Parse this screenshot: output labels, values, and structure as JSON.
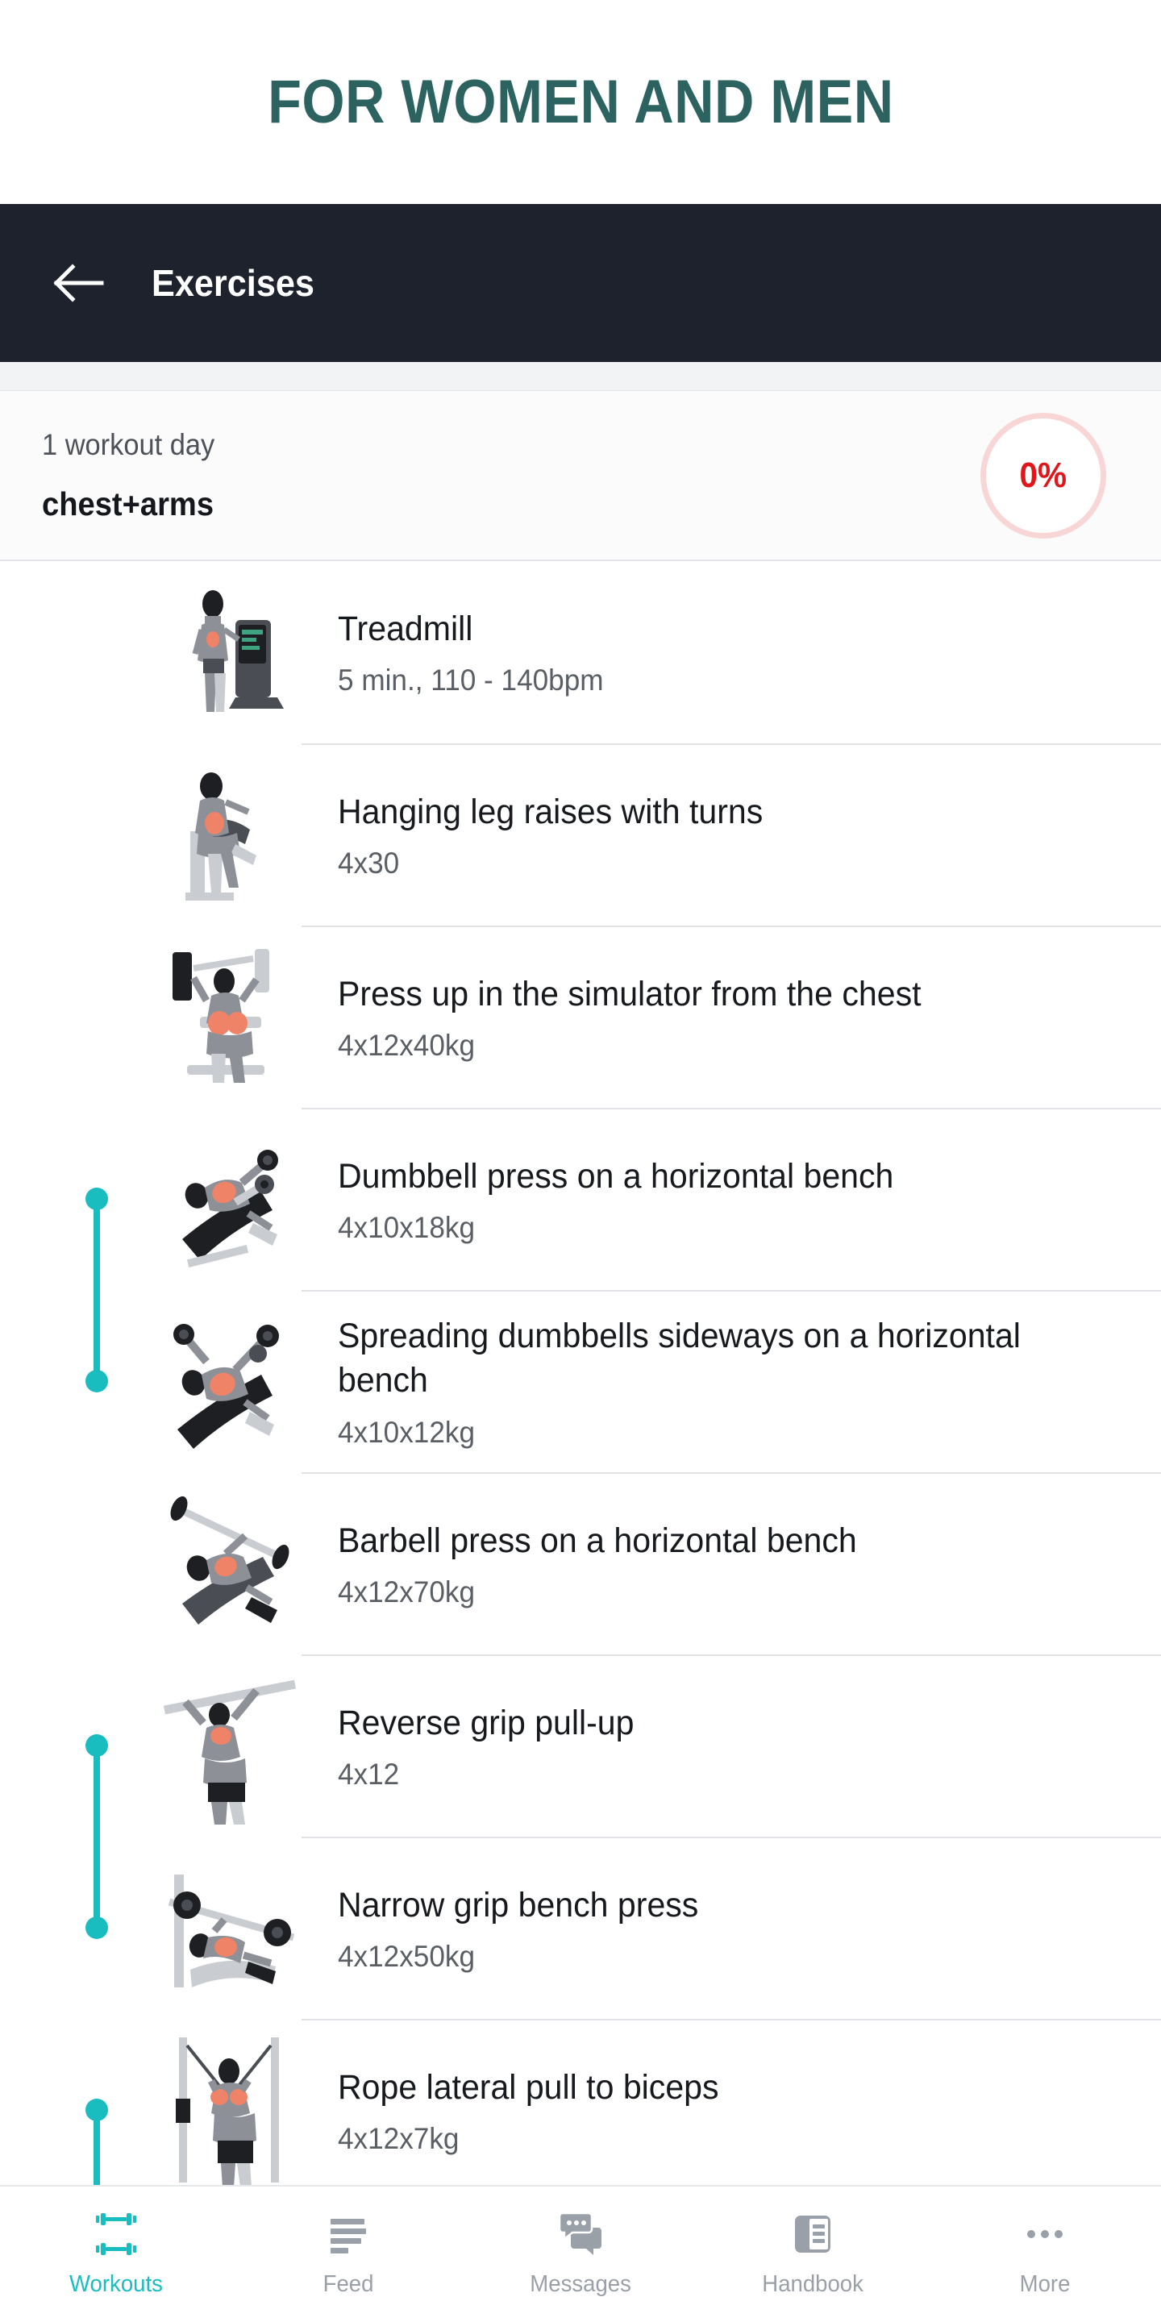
{
  "promo": {
    "title": "FOR WOMEN AND MEN",
    "color": "#2c6260"
  },
  "appbar": {
    "title": "Exercises",
    "back_icon": "arrow-left-icon",
    "background": "#1d222c"
  },
  "day_summary": {
    "count_label": "1 workout day",
    "name": "chest+arms",
    "progress": "0%",
    "progress_color": "#e0161a",
    "progress_ring_color": "#f8d6d6"
  },
  "superset_color": "#19bdc0",
  "exercises": [
    {
      "name": "Treadmill",
      "sets": "5 min., 110 - 140bpm",
      "thumb": "treadmill-figure",
      "superset": "none"
    },
    {
      "name": "Hanging leg raises with turns",
      "sets": "4x30",
      "thumb": "leg-raise-figure",
      "superset": "none"
    },
    {
      "name": "Press up in the simulator from the chest",
      "sets": "4x12x40kg",
      "thumb": "chest-press-machine-figure",
      "superset": "none"
    },
    {
      "name": "Dumbbell press on a horizontal bench",
      "sets": "4x10x18kg",
      "thumb": "dumbbell-press-figure",
      "superset": "start"
    },
    {
      "name": "Spreading dumbbells sideways on a horizontal bench",
      "sets": "4x10x12kg",
      "thumb": "dumbbell-fly-figure",
      "superset": "end"
    },
    {
      "name": "Barbell press on a horizontal bench",
      "sets": "4x12x70kg",
      "thumb": "barbell-press-figure",
      "superset": "none"
    },
    {
      "name": "Reverse grip pull-up",
      "sets": "4x12",
      "thumb": "pullup-figure",
      "superset": "start"
    },
    {
      "name": "Narrow grip bench press",
      "sets": "4x12x50kg",
      "thumb": "narrow-bench-figure",
      "superset": "end"
    },
    {
      "name": "Rope lateral pull to biceps",
      "sets": "4x12x7kg",
      "thumb": "cable-curl-figure",
      "superset": "open"
    }
  ],
  "bottom_nav": [
    {
      "label": "Workouts",
      "icon": "dumbbells-icon",
      "active": true
    },
    {
      "label": "Feed",
      "icon": "feed-lines-icon",
      "active": false
    },
    {
      "label": "Messages",
      "icon": "chat-bubbles-icon",
      "active": false
    },
    {
      "label": "Handbook",
      "icon": "book-icon",
      "active": false
    },
    {
      "label": "More",
      "icon": "ellipsis-icon",
      "active": false
    }
  ]
}
